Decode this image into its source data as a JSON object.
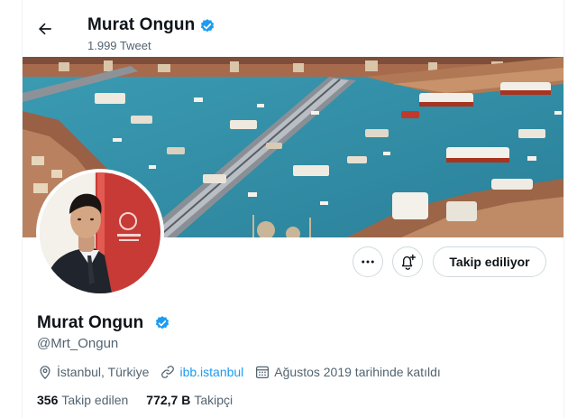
{
  "header": {
    "name": "Murat Ongun",
    "tweet_count": "1.999 Tweet"
  },
  "profile": {
    "name": "Murat Ongun",
    "handle": "@Mrt_Ongun",
    "location": "İstanbul, Türkiye",
    "website": "ibb.istanbul",
    "joined": "Ağustos 2019 tarihinde katıldı"
  },
  "actions": {
    "more_icon": "more-horizontal-icon",
    "notify_icon": "bell-plus-icon",
    "follow_label": "Takip ediliyor"
  },
  "stats": {
    "following_count": "356",
    "following_label": "Takip edilen",
    "followers_count": "772,7 B",
    "followers_label": "Takipçi"
  },
  "colors": {
    "accent": "#1d9bf0",
    "text": "#0f1419",
    "secondary": "#536471",
    "border": "#cfd9de"
  }
}
